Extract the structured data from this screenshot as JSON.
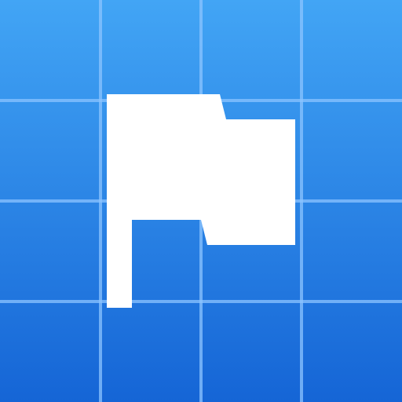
{
  "icon": {
    "name": "flag-icon",
    "colors": {
      "gradient_top": "#42a5f5",
      "gradient_bottom": "#1565d6",
      "grid_line": "#8cc4ff",
      "flag": "#ffffff"
    },
    "grid": {
      "columns": 4,
      "rows": 4
    }
  }
}
